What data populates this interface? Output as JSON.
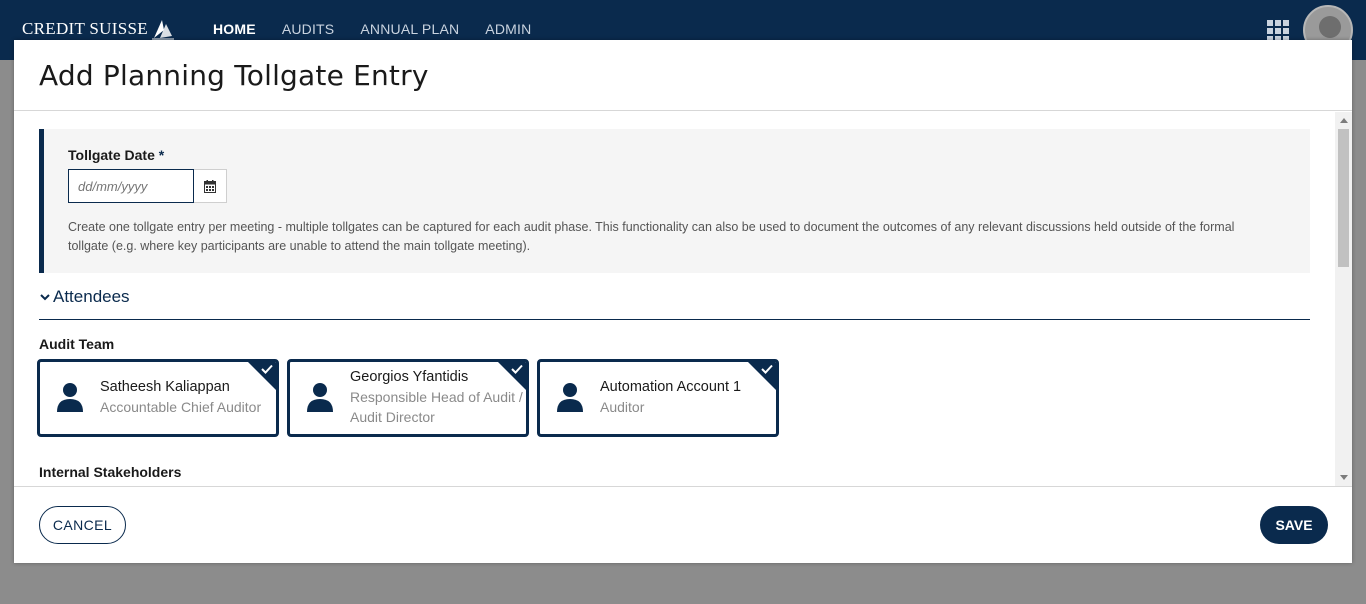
{
  "nav": {
    "brand": "CREDIT SUISSE",
    "items": [
      {
        "label": "HOME",
        "active": true
      },
      {
        "label": "AUDITS",
        "active": false
      },
      {
        "label": "ANNUAL PLAN",
        "active": false
      },
      {
        "label": "ADMIN",
        "active": false
      }
    ]
  },
  "modal": {
    "title": "Add Planning Tollgate Entry",
    "tollgate": {
      "label": "Tollgate Date",
      "required_marker": "*",
      "placeholder": "dd/mm/yyyy",
      "value": "",
      "help_text": "Create one tollgate entry per meeting - multiple tollgates can be captured  for each audit phase.  This functionality can also be used to document the outcomes of any relevant discussions held outside of the formal tollgate (e.g. where key participants are unable to attend the main tollgate meeting)."
    },
    "attendees": {
      "section_label": "Attendees",
      "expanded": true,
      "audit_team_title": "Audit Team",
      "audit_team": [
        {
          "name": "Satheesh Kaliappan",
          "role": "Accountable Chief Auditor",
          "selected": true
        },
        {
          "name": "Georgios Yfantidis",
          "role": "Responsible Head of Audit / Audit Director",
          "selected": true
        },
        {
          "name": "Automation Account 1",
          "role": "Auditor",
          "selected": true
        }
      ],
      "internal_stakeholders_title": "Internal Stakeholders"
    },
    "footer": {
      "cancel_label": "CANCEL",
      "save_label": "SAVE"
    }
  },
  "colors": {
    "brand_navy": "#0a2a4d",
    "overlay_gray": "#8c8c8c"
  },
  "icons": {
    "calendar": "calendar-icon",
    "chevron": "chevron-down-icon",
    "person": "person-icon",
    "check": "check-icon",
    "apps": "apps-grid-icon"
  }
}
